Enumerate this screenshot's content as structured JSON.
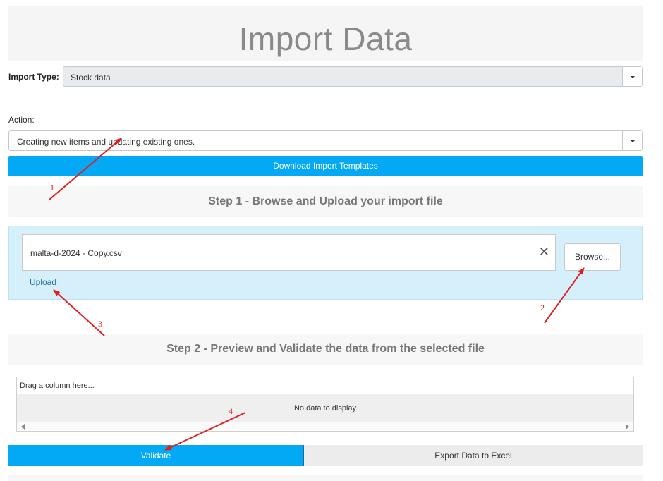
{
  "page": {
    "title": "Import Data"
  },
  "import_type": {
    "label": "Import Type:",
    "value": "Stock data"
  },
  "action": {
    "label": "Action:",
    "value": "Creating new items and updating existing ones."
  },
  "download_button": {
    "label": "Download Import Templates"
  },
  "step1": {
    "title": "Step 1 - Browse and Upload your import file",
    "file_name": "malta-d-2024 - Copy.csv",
    "clear_symbol": "✕",
    "browse_label": "Browse...",
    "upload_label": "Upload"
  },
  "step2": {
    "title": "Step 2 - Preview and Validate the data from the selected file",
    "group_panel_text": "Drag a column here...",
    "empty_text": "No data to display"
  },
  "actions": {
    "validate_label": "Validate",
    "export_label": "Export Data to Excel"
  },
  "annotations": {
    "labels": [
      "1",
      "2",
      "3",
      "4"
    ],
    "color": "#e02020"
  },
  "colors": {
    "accent": "#03a9f4",
    "upload_panel": "#d5f0fb",
    "title_text": "#8a8a8a"
  }
}
